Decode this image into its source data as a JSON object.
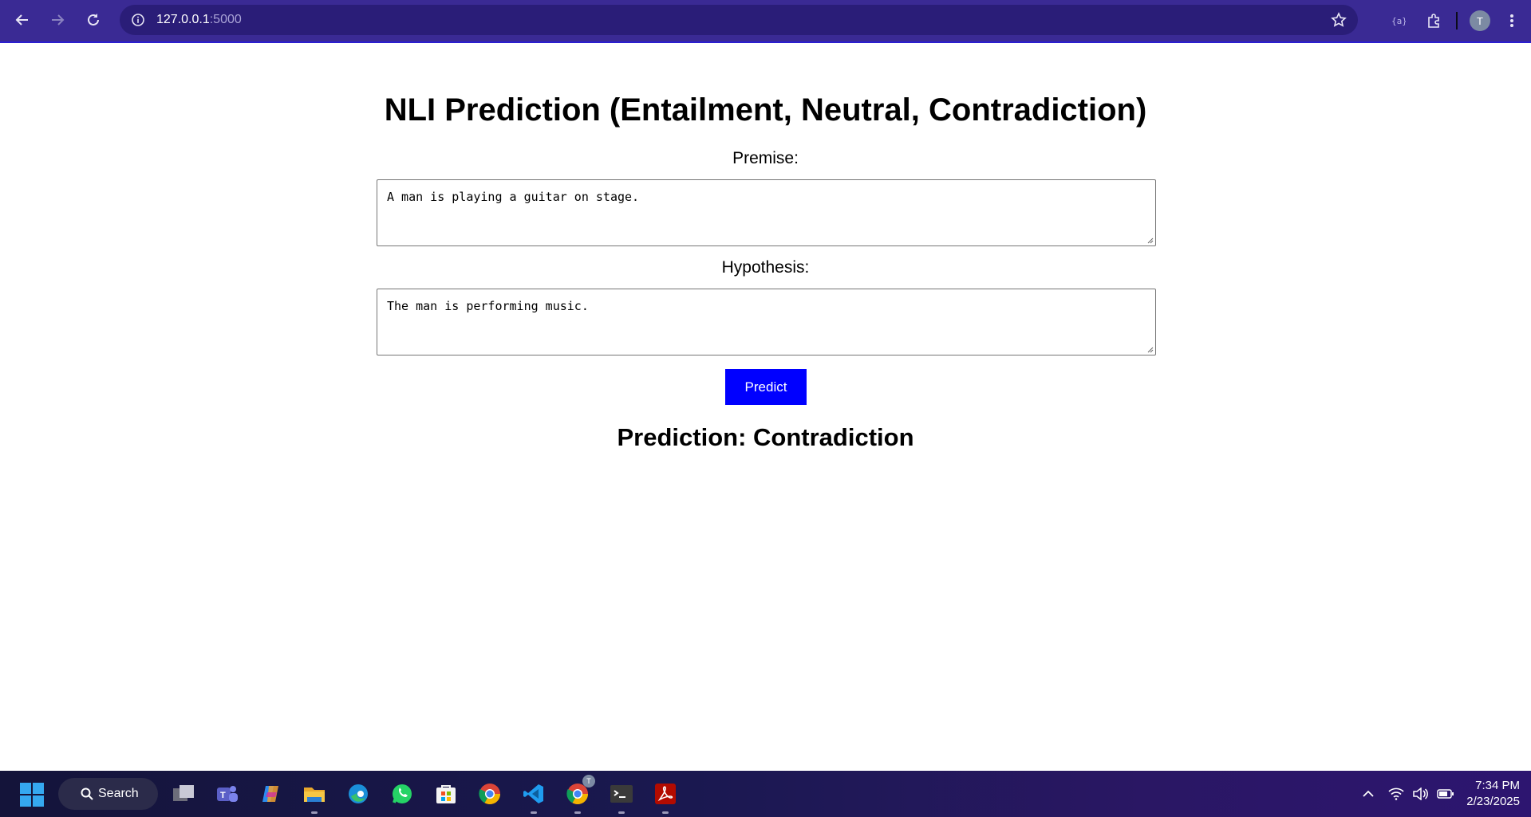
{
  "browser": {
    "url_host": "127.0.0.1",
    "url_port": ":5000",
    "profile_initial": "T",
    "colors": {
      "toolbar": "#3a2a94",
      "omnibox": "#2a1d78"
    }
  },
  "page": {
    "title": "NLI Prediction (Entailment, Neutral, Contradiction)",
    "premise_label": "Premise:",
    "premise_value": "A man is playing a guitar on stage.",
    "hypothesis_label": "Hypothesis:",
    "hypothesis_value": "The man is performing music.",
    "predict_label": "Predict",
    "result": "Prediction: Contradiction",
    "colors": {
      "predict_button": "#0000ff"
    }
  },
  "taskbar": {
    "search_label": "Search",
    "apps": [
      "task-view",
      "teams",
      "copilot",
      "file-explorer",
      "edge",
      "whatsapp",
      "microsoft-store",
      "chrome",
      "vscode",
      "chrome-profile",
      "terminal",
      "acrobat"
    ],
    "chrome_profile_badge": "T",
    "time": "7:34 PM",
    "date": "2/23/2025"
  }
}
